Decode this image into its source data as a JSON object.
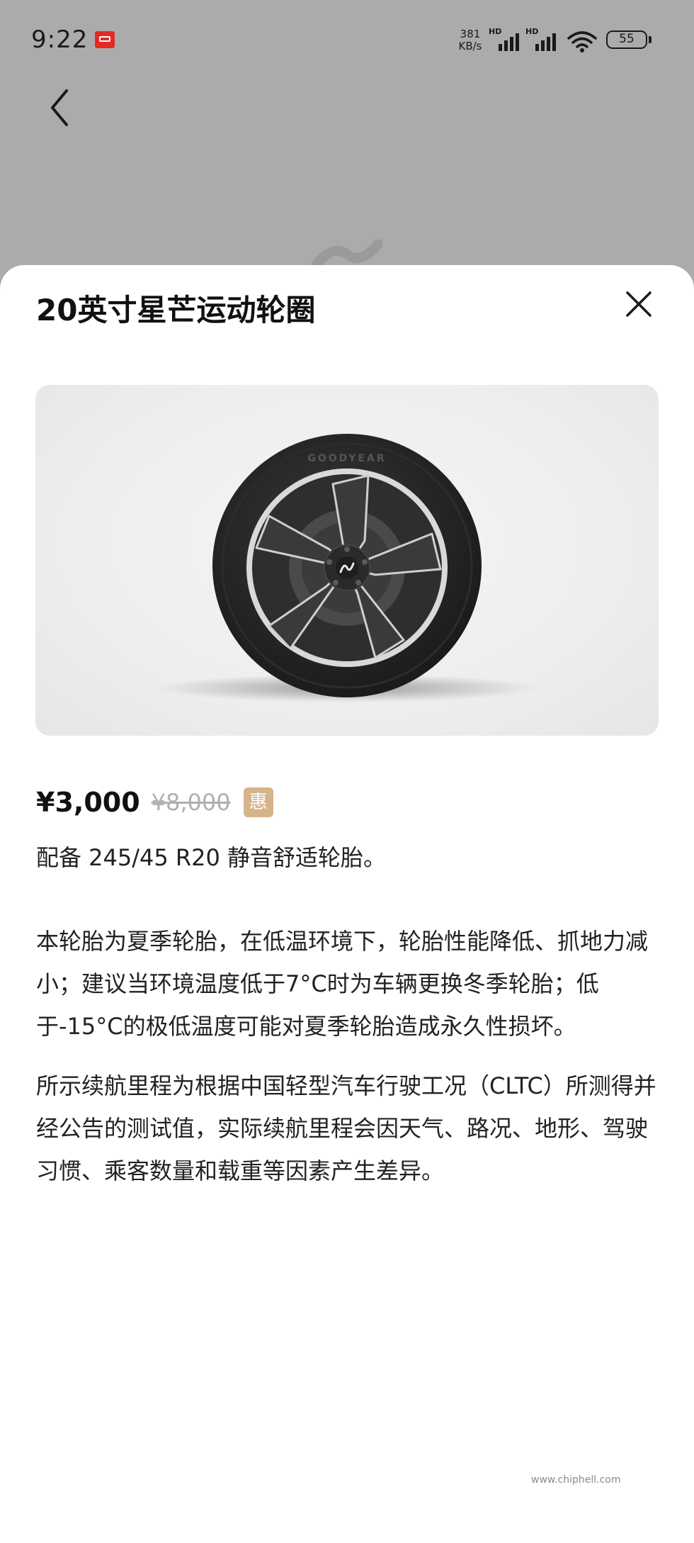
{
  "status_bar": {
    "time": "9:22",
    "net_speed": "381",
    "net_speed_unit": "KB/s",
    "sim1_label": "HD",
    "sim2_label": "HD",
    "battery": "55"
  },
  "sheet": {
    "title": "20英寸星芒运动轮圈",
    "price": "¥3,000",
    "original_price": "¥8,000",
    "promo_badge": "惠",
    "desc_1": "配备 245/45 R20 静音舒适轮胎。",
    "desc_2": "本轮胎为夏季轮胎，在低温环境下，轮胎性能降低、抓地力减小；建议当环境温度低于7°C时为车辆更换冬季轮胎；低于-15°C的极低温度可能对夏季轮胎造成永久性损坏。",
    "desc_3": "所示续航里程为根据中国轻型汽车行驶工况（CLTC）所测得并经公告的测试值，实际续航里程会因天气、路况、地形、驾驶习惯、乘客数量和载重等因素产生差异。"
  },
  "wheel_image": {
    "tire_brand": "GOODYEAR"
  },
  "watermark": {
    "site": "www.chiphell.com"
  },
  "colors": {
    "overlay": "#ababab",
    "sheet_bg": "#ffffff",
    "badge": "#d6b48a",
    "strike_price": "#b0b0b0"
  },
  "icons": {
    "back": "chevron-left-icon",
    "close": "close-icon",
    "signal": "signal-icon",
    "wifi": "wifi-icon",
    "battery": "battery-icon"
  }
}
